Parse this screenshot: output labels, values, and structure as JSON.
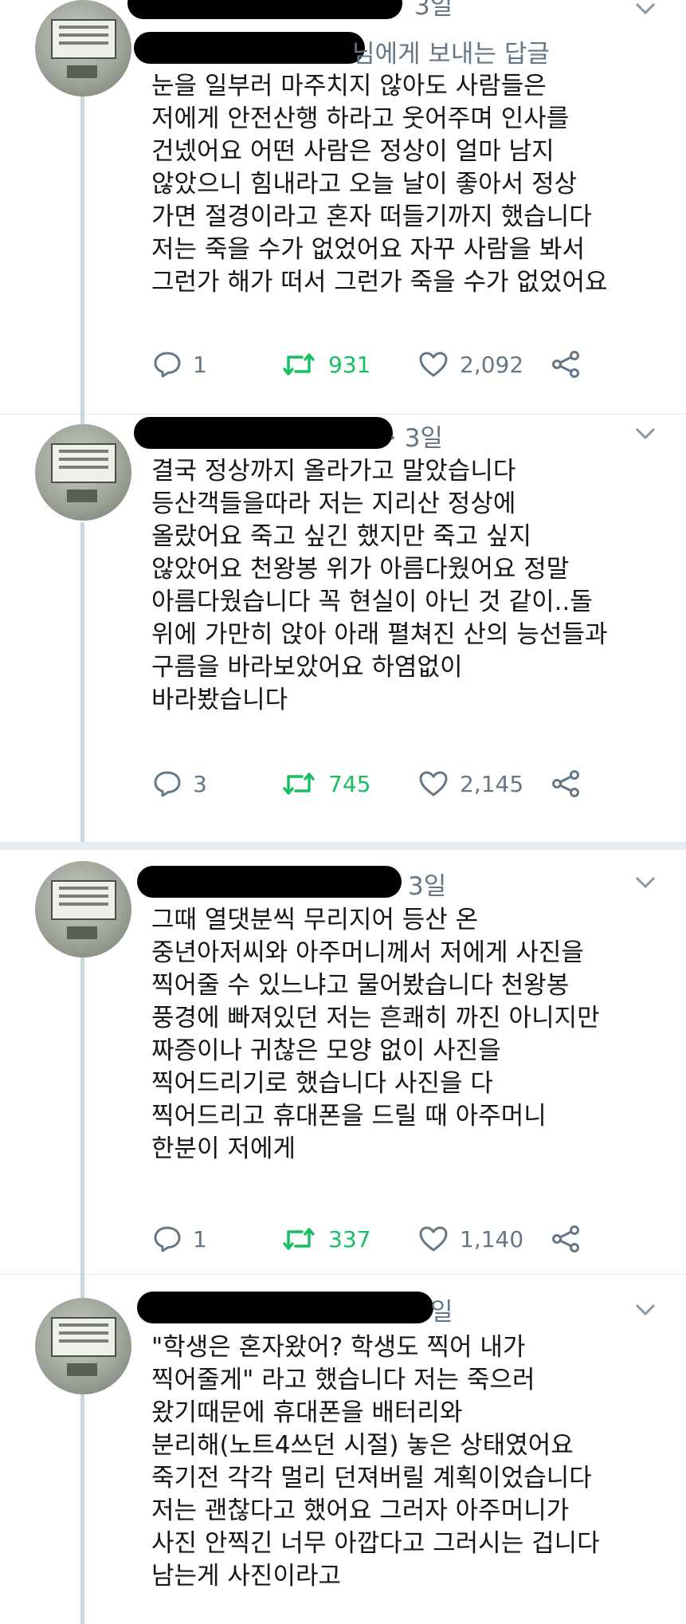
{
  "tweets": [
    {
      "reply_to": "님에게 보내는 답글",
      "time": "3일",
      "body": "눈을 일부러 마주치지 않아도 사람들은\n저에게 안전산행 하라고 웃어주며 인사를\n건넸어요 어떤 사람은 정상이 얼마 남지\n않았으니 힘내라고 오늘 날이 좋아서 정상\n가면 절경이라고 혼자 떠들기까지 했습니다\n저는 죽을 수가 없었어요 자꾸 사람을 봐서\n그런가 해가 떠서 그런가 죽을 수가 없었어요",
      "replies": "1",
      "retweets": "931",
      "likes": "2,092"
    },
    {
      "time": "· 3일",
      "body": "결국 정상까지 올라가고 말았습니다\n등산객들을따라 저는 지리산 정상에\n올랐어요 죽고 싶긴 했지만 죽고 싶지\n않았어요 천왕봉 위가 아름다웠어요 정말\n아름다웠습니다 꼭 현실이 아닌 것 같이..돌\n위에 가만히 앉아 아래 펼쳐진 산의 능선들과\n구름을 바라보았어요 하염없이\n바라봤습니다",
      "replies": "3",
      "retweets": "745",
      "likes": "2,145"
    },
    {
      "time": "3일",
      "body": "그때 열댓분씩 무리지어 등산 온\n중년아저씨와 아주머니께서 저에게 사진을\n찍어줄 수 있느냐고 물어봤습니다 천왕봉\n풍경에 빠져있던 저는 흔쾌히 까진 아니지만\n짜증이나 귀찮은 모양 없이 사진을\n찍어드리기로 했습니다 사진을 다\n찍어드리고 휴대폰을 드릴 때 아주머니\n한분이 저에게",
      "replies": "1",
      "retweets": "337",
      "likes": "1,140"
    },
    {
      "time": "일",
      "body": "\"학생은 혼자왔어? 학생도 찍어 내가\n찍어줄게\" 라고 했습니다 저는 죽으러\n왔기때문에 휴대폰을 배터리와\n분리해(노트4쓰던 시절) 놓은 상태였어요\n죽기전 각각 멀리 던져버릴 계획이었습니다\n저는 괜찮다고 했어요 그러자 아주머니가\n사진 안찍긴 너무 아깝다고 그러시는 겁니다\n남는게 사진이라고"
    }
  ]
}
